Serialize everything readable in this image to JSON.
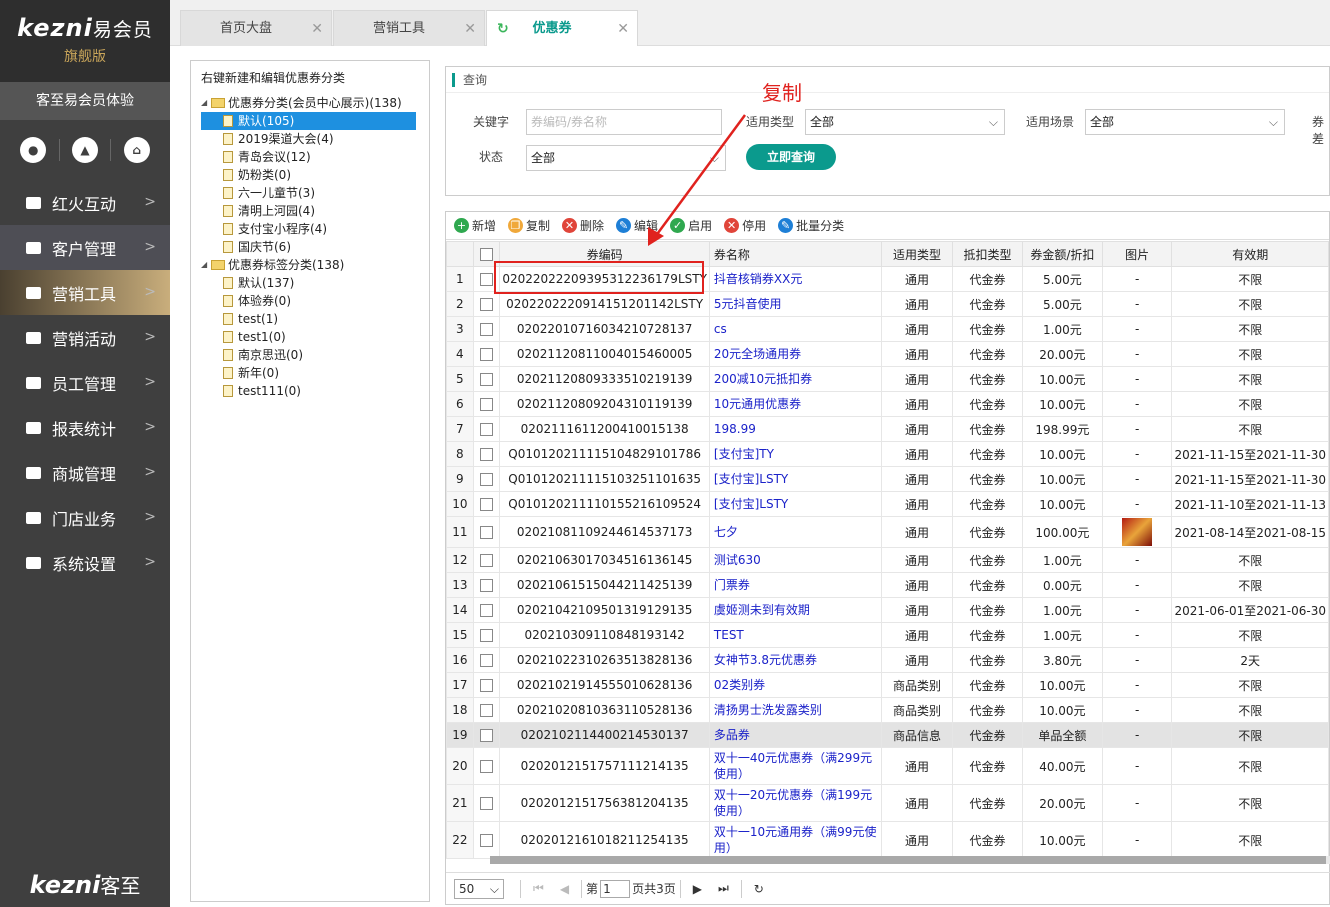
{
  "brand": {
    "logo": "kezni",
    "logo_cn": "易会员",
    "edition": "旗舰版"
  },
  "user_name": "客至易会员体验",
  "quick_icons": [
    "user-icon",
    "bell-icon",
    "home-icon"
  ],
  "nav": [
    {
      "label": "红火互动"
    },
    {
      "label": "客户管理"
    },
    {
      "label": "营销工具"
    },
    {
      "label": "营销活动"
    },
    {
      "label": "员工管理"
    },
    {
      "label": "报表统计"
    },
    {
      "label": "商城管理"
    },
    {
      "label": "门店业务"
    },
    {
      "label": "系统设置"
    }
  ],
  "footer_logo": {
    "en": "kezni",
    "cn": "客至"
  },
  "tabs": [
    {
      "label": "首页大盘"
    },
    {
      "label": "营销工具"
    },
    {
      "label": "优惠券"
    }
  ],
  "tree": {
    "header": "右键新建和编辑优惠券分类",
    "group1": "优惠券分类(会员中心展示)(138)",
    "items1": [
      "默认(105)",
      "2019渠道大会(4)",
      "青岛会议(12)",
      "奶粉类(0)",
      "六一儿童节(3)",
      "清明上河园(4)",
      "支付宝小程序(4)",
      "国庆节(6)"
    ],
    "group2": "优惠券标签分类(138)",
    "items2": [
      "默认(137)",
      "体验券(0)",
      "test(1)",
      "test1(0)",
      "南京思迅(0)",
      "新年(0)",
      "test111(0)"
    ]
  },
  "query": {
    "title": "查询",
    "keyword_label": "关键字",
    "keyword_placeholder": "券编码/券名称",
    "type_label": "适用类型",
    "type_value": "全部",
    "scene_label": "适用场景",
    "scene_value": "全部",
    "more_label": "券差",
    "status_label": "状态",
    "status_value": "全部",
    "search_button": "立即查询"
  },
  "annotation": {
    "label": "复制"
  },
  "toolbar": [
    "新增",
    "复制",
    "删除",
    "编辑",
    "启用",
    "停用",
    "批量分类"
  ],
  "columns": [
    "券编码",
    "券名称",
    "适用类型",
    "抵扣类型",
    "券金额/折扣",
    "图片",
    "有效期"
  ],
  "rows": [
    [
      "1",
      "020220222093953122361 79LSTY",
      "抖音核销券XX元",
      "通用",
      "代金券",
      "5.00元",
      "-",
      "不限"
    ],
    [
      "2",
      "020220222091415120114 2LSTY",
      "5元抖音使用",
      "通用",
      "代金券",
      "5.00元",
      "-",
      "不限"
    ],
    [
      "3",
      "0202201071603421 0728137",
      "cs",
      "通用",
      "代金券",
      "1.00元",
      "-",
      "不限"
    ],
    [
      "4",
      "020211208110040154600 05",
      "20元全场通用券",
      "通用",
      "代金券",
      "20.00元",
      "-",
      "不限"
    ],
    [
      "5",
      "020211208093335102191 39",
      "200减10元抵扣券",
      "通用",
      "代金券",
      "10.00元",
      "-",
      "不限"
    ],
    [
      "6",
      "020211208092043101191 39",
      "10元通用优惠券",
      "通用",
      "代金券",
      "10.00元",
      "-",
      "不限"
    ],
    [
      "7",
      "020211161120041001513 8",
      "198.99",
      "通用",
      "代金券",
      "198.99元",
      "-",
      "不限"
    ],
    [
      "8",
      "Q01012021111510482910 1786",
      "[支付宝]TY",
      "通用",
      "代金券",
      "10.00元",
      "-",
      "2021-11-15至2021-11-30"
    ],
    [
      "9",
      "Q01012021111510325110 1635",
      "[支付宝]LSTY",
      "通用",
      "代金券",
      "10.00元",
      "-",
      "2021-11-15至2021-11-30"
    ],
    [
      "10",
      "Q01012021111015521610 9524",
      "[支付宝]LSTY",
      "通用",
      "代金券",
      "10.00元",
      "-",
      "2021-11-10至2021-11-13"
    ],
    [
      "11",
      "020210811092446145371 73",
      "七夕",
      "通用",
      "代金券",
      "100.00元",
      "img",
      "2021-08-14至2021-08-15"
    ],
    [
      "12",
      "020210630170345161361 45",
      "测试630",
      "通用",
      "代金券",
      "1.00元",
      "-",
      "不限"
    ],
    [
      "13",
      "020210615150442114251 39",
      "门票券",
      "通用",
      "代金券",
      "0.00元",
      "-",
      "不限"
    ],
    [
      "14",
      "020210421095013191291 35",
      "虞姬测未到有效期",
      "通用",
      "代金券",
      "1.00元",
      "-",
      "2021-06-01至2021-06-30"
    ],
    [
      "15",
      "020210309110848193142",
      "TEST",
      "通用",
      "代金券",
      "1.00元",
      "-",
      "不限"
    ],
    [
      "16",
      "020210223102635138281 36",
      "女神节3.8元优惠券",
      "通用",
      "代金券",
      "3.80元",
      "-",
      "2天"
    ],
    [
      "17",
      "020210219145550106281 36",
      "02类别券",
      "商品类别",
      "代金券",
      "10.00元",
      "-",
      "不限"
    ],
    [
      "18",
      "020210208103631105281 36",
      "清扬男士洗发露类别",
      "商品类别",
      "代金券",
      "10.00元",
      "-",
      "不限"
    ],
    [
      "19",
      "020210211440021453013 7",
      "多品券",
      "商品信息",
      "代金券",
      "单品全额",
      "-",
      "不限"
    ],
    [
      "20",
      "020201215175711121413 5",
      "双十一40元优惠券（满299元使用）",
      "通用",
      "代金券",
      "40.00元",
      "-",
      "不限"
    ],
    [
      "21",
      "020201215175638120413 5",
      "双十一20元优惠券（满199元使用）",
      "通用",
      "代金券",
      "20.00元",
      "-",
      "不限"
    ],
    [
      "22",
      "020201216101821125413 5",
      "双十一10元通用券（满99元使用）",
      "通用",
      "代金券",
      "10.00元",
      "-",
      "不限"
    ]
  ],
  "pager": {
    "page_size": "50",
    "page_prefix": "第",
    "page_value": "1",
    "page_suffix": "页共3页"
  }
}
